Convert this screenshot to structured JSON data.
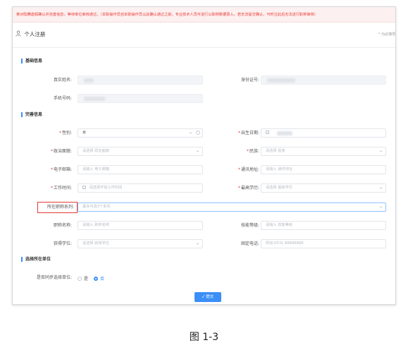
{
  "notice": {
    "text": "黄对隐瞒虚假确认并完善信息，等待单位审核通过。（本职操作员自本职操作员以此确认通过之前，专业技术人员可进行以职称数据录入，若无法提交确认，可时注此后无法进行职称审核）"
  },
  "header": {
    "title": "个人注册",
    "hint": "* 为必填项"
  },
  "sections": {
    "basic": "基础信息",
    "complete": "完善信息",
    "unit": "选择所在单位"
  },
  "fields": {
    "real_name_label": "真实姓名:",
    "id_card_label": "身份证号:",
    "phone_label": "手机号码:",
    "gender_label": "性别:",
    "gender_value": "女",
    "birth_label": "出生日期:",
    "political_label": "政治面貌:",
    "political_placeholder": "请选择 政治面貌",
    "ethnic_label": "民族:",
    "ethnic_placeholder": "请选择 民族",
    "email_label": "电子邮箱:",
    "email_placeholder": "请输入 电子邮箱",
    "address_label": "通讯地址:",
    "address_placeholder": "请输入 通讯地址",
    "worktime_label": "工作时间:",
    "worktime_placeholder": "请选择开始工作时间",
    "education_label": "最高学历:",
    "education_placeholder": "请选择 最高学历",
    "series_label": "所在职称系列:",
    "series_placeholder": "最多可选3个系列",
    "title_label": "职称名称:",
    "title_placeholder": "请输入 职称名称",
    "skill_label": "技能等级:",
    "skill_placeholder": "请输入 技能等级",
    "degree_label": "获得学位:",
    "degree_placeholder": "请选择 获得学位",
    "telephone_label": "固定电话:",
    "telephone_placeholder": "例如:0531-88888888",
    "sync_label": "是否同步选择单位:",
    "sync_yes": "是",
    "sync_no": "否"
  },
  "submit_label": "✓ 提交",
  "caption": "图 1-3",
  "colors": {
    "accent": "#3b8ff7",
    "highlight": "#e33a36",
    "notice_text": "#e8403c"
  }
}
